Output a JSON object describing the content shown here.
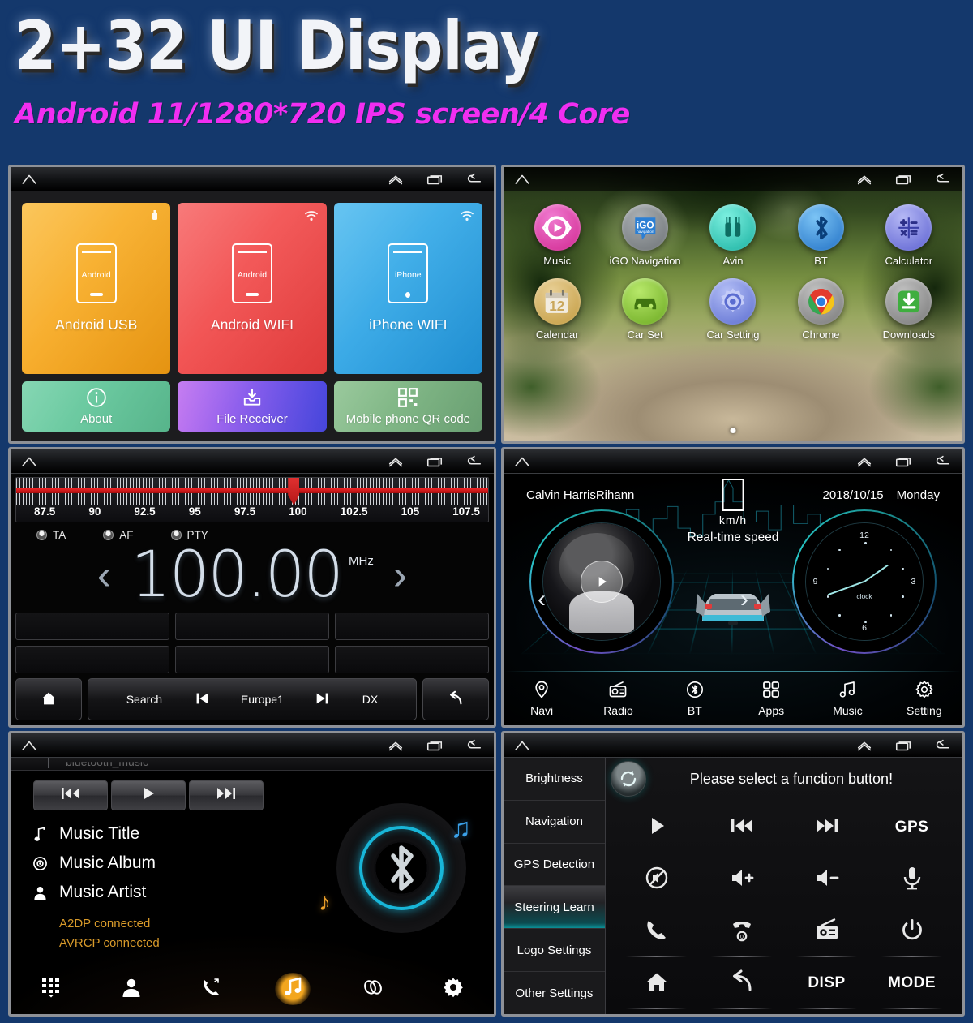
{
  "header": {
    "title": "2+32 UI Display",
    "subtitle": "Android 11/1280*720 IPS screen/4 Core"
  },
  "colors": {
    "page_bg": "#14386c",
    "title_color": "#f2f4f8",
    "subtitle_color": "#f12ef1",
    "accent_orange": "#f3a61f",
    "accent_teal": "#0b8f96",
    "bt_cyan": "#18b6d8",
    "radio_red": "#ff2a2a",
    "status_amber": "#d89a2a"
  },
  "sysbar": {
    "home_icon": "home-icon",
    "up_icon": "chevron-up-icon",
    "recents_icon": "recents-icon",
    "back_icon": "back-icon"
  },
  "panel_link": {
    "tiles_top": [
      {
        "label": "Android USB",
        "device_label": "Android",
        "corner_icon": "usb-icon",
        "color": "#f5a623"
      },
      {
        "label": "Android WIFI",
        "device_label": "Android",
        "corner_icon": "wifi-icon",
        "color": "#ef4a4a"
      },
      {
        "label": "iPhone WIFI",
        "device_label": "iPhone",
        "corner_icon": "wifi-icon",
        "color": "#2fa8e8"
      }
    ],
    "tiles_bottom": [
      {
        "label": "About",
        "icon": "info-icon",
        "color": "#6cc8a0"
      },
      {
        "label": "File Receiver",
        "icon": "inbox-down-icon",
        "color": "#9b59e0"
      },
      {
        "label": "Mobile phone QR code",
        "icon": "qr-icon",
        "color": "#7fb383"
      }
    ]
  },
  "panel_launcher": {
    "apps": [
      {
        "label": "Music",
        "icon": "music-play-icon",
        "color": "#e0409f"
      },
      {
        "label": "iGO Navigation",
        "icon": "igo-icon",
        "color": "#8b8f93"
      },
      {
        "label": "Avin",
        "icon": "avin-plug-icon",
        "color": "#2ecfc0"
      },
      {
        "label": "BT",
        "icon": "bluetooth-icon",
        "color": "#2f8fe0"
      },
      {
        "label": "Calculator",
        "icon": "calculator-icon",
        "color": "#7b7fe0"
      },
      {
        "label": "Calendar",
        "icon": "calendar-icon",
        "color": "#d9a94a"
      },
      {
        "label": "Car Set",
        "icon": "car-icon",
        "color": "#8ec83c"
      },
      {
        "label": "Car Setting",
        "icon": "gear-icon",
        "color": "#7b8fe0"
      },
      {
        "label": "Chrome",
        "icon": "chrome-icon",
        "color": "#9a9a9a"
      },
      {
        "label": "Downloads",
        "icon": "download-icon",
        "color": "#9a9a9a"
      }
    ],
    "page_indicator": "1"
  },
  "panel_radio": {
    "band_ticks": [
      "87.5",
      "90",
      "92.5",
      "95",
      "97.5",
      "100",
      "102.5",
      "105",
      "107.5"
    ],
    "rds_options": [
      "TA",
      "AF",
      "PTY"
    ],
    "frequency": "100.00",
    "unit": "MHz",
    "prev_icon": "chevron-left-icon",
    "next_icon": "chevron-right-icon",
    "presets": [
      "",
      "",
      "",
      "",
      "",
      ""
    ],
    "bottom_bar": {
      "home_icon": "home-icon",
      "search_label": "Search",
      "prev_track_icon": "skip-back-icon",
      "region_label": "Europe1",
      "next_track_icon": "skip-forward-icon",
      "dx_label": "DX",
      "back_icon": "return-icon"
    }
  },
  "panel_dashboard": {
    "track_text": "Calvin HarrisRihann",
    "date": "2018/10/15",
    "weekday": "Monday",
    "speed_unit": "km/h",
    "speed_label": "Real-time speed",
    "clock_label": "clock",
    "clock_numerals": [
      "12",
      "3",
      "6",
      "9"
    ],
    "play_icon": "play-icon",
    "prev_icon": "chevron-left-icon",
    "next_icon": "chevron-right-icon",
    "nav_items": [
      {
        "label": "Navi",
        "icon": "location-pin-icon"
      },
      {
        "label": "Radio",
        "icon": "radio-icon"
      },
      {
        "label": "BT",
        "icon": "bluetooth-circle-icon"
      },
      {
        "label": "Apps",
        "icon": "apps-grid-icon"
      },
      {
        "label": "Music",
        "icon": "music-note-icon"
      },
      {
        "label": "Setting",
        "icon": "gear-icon"
      }
    ]
  },
  "panel_bt_music": {
    "window_title": "bluetooth_music",
    "transport": [
      {
        "icon": "prev-track-icon"
      },
      {
        "icon": "play-icon"
      },
      {
        "icon": "next-track-icon"
      }
    ],
    "info": [
      {
        "label": "Music Title",
        "icon": "note-icon"
      },
      {
        "label": "Music Album",
        "icon": "disc-icon"
      },
      {
        "label": "Music Artist",
        "icon": "person-icon"
      }
    ],
    "status": [
      "A2DP connected",
      "AVRCP connected"
    ],
    "nav_items": [
      {
        "name": "dialpad",
        "icon": "dialpad-icon",
        "active": false
      },
      {
        "name": "contacts",
        "icon": "person-icon",
        "active": false
      },
      {
        "name": "calls",
        "icon": "call-history-icon",
        "active": false
      },
      {
        "name": "music",
        "icon": "music-note-icon",
        "active": true
      },
      {
        "name": "link",
        "icon": "link-icon",
        "active": false
      },
      {
        "name": "settings",
        "icon": "gear-icon",
        "active": false
      }
    ]
  },
  "panel_settings": {
    "sidebar": [
      {
        "label": "Brightness",
        "selected": false
      },
      {
        "label": "Navigation",
        "selected": false
      },
      {
        "label": "GPS Detection",
        "selected": false
      },
      {
        "label": "Steering Learn",
        "selected": true
      },
      {
        "label": "Logo Settings",
        "selected": false
      },
      {
        "label": "Other Settings",
        "selected": false
      }
    ],
    "prompt": "Please select a function button!",
    "refresh_icon": "refresh-icon",
    "functions": [
      {
        "label": "",
        "icon": "play-icon"
      },
      {
        "label": "",
        "icon": "prev-track-icon"
      },
      {
        "label": "",
        "icon": "next-track-icon"
      },
      {
        "label": "GPS",
        "icon": "text-icon"
      },
      {
        "label": "",
        "icon": "mute-icon"
      },
      {
        "label": "",
        "icon": "volume-up-icon"
      },
      {
        "label": "",
        "icon": "volume-down-icon"
      },
      {
        "label": "",
        "icon": "microphone-icon"
      },
      {
        "label": "",
        "icon": "call-answer-icon"
      },
      {
        "label": "",
        "icon": "call-end-icon"
      },
      {
        "label": "",
        "icon": "radio-icon"
      },
      {
        "label": "",
        "icon": "power-icon"
      },
      {
        "label": "",
        "icon": "home-icon"
      },
      {
        "label": "",
        "icon": "return-icon"
      },
      {
        "label": "DISP",
        "icon": "text-icon"
      },
      {
        "label": "MODE",
        "icon": "text-icon"
      }
    ]
  }
}
